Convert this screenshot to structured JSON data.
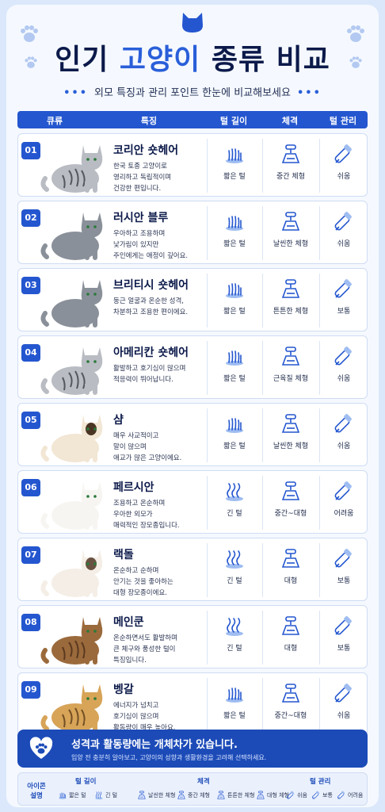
{
  "colors": {
    "accent": "#2456cf",
    "title": "#0c1a4a",
    "highlight": "#2a5fd9"
  },
  "header": {
    "title_part1": "인기",
    "title_hl": "고양이",
    "title_part2": "종류 비교",
    "subtitle": "외모 특징과 관리 포인트 한눈에 비교해보세요"
  },
  "columns": [
    "큐류",
    "특징",
    "털 길이",
    "체격",
    "털 관리"
  ],
  "breeds": [
    {
      "num": "01",
      "name": "코리안 숏헤어",
      "desc": [
        "한국 토종 고양이로",
        "영리하고 독립적이며",
        "건강한 편입니다."
      ],
      "fur": "짧은 털",
      "fur_icon": "short-fur-icon",
      "body": "중간 체형",
      "care": "쉬움",
      "coat": "tabby-silver"
    },
    {
      "num": "02",
      "name": "러시안 블루",
      "desc": [
        "우아하고 조용하며",
        "낯가림이 있지만",
        "주인에게는 애정이 깊어요."
      ],
      "fur": "짧은 털",
      "fur_icon": "short-fur-icon",
      "body": "날씬한 체형",
      "care": "쉬움",
      "coat": "gray"
    },
    {
      "num": "03",
      "name": "브리티시 숏헤어",
      "desc": [
        "둥근 얼굴과 온순한 성격,",
        "차분하고 조용한 편이에요."
      ],
      "fur": "짧은 털",
      "fur_icon": "short-fur-icon",
      "body": "튼튼한 체형",
      "care": "보통",
      "coat": "gray"
    },
    {
      "num": "04",
      "name": "아메리칸 숏헤어",
      "desc": [
        "활발하고 호기심이 많으며",
        "적응력이 뛰어납니다."
      ],
      "fur": "짧은 털",
      "fur_icon": "short-fur-icon",
      "body": "근육질 체형",
      "care": "쉬움",
      "coat": "tabby-silver"
    },
    {
      "num": "05",
      "name": "샴",
      "desc": [
        "매우 사교적이고",
        "말이 많으며",
        "애교가 많은 고양이에요."
      ],
      "fur": "짧은 털",
      "fur_icon": "short-fur-icon",
      "body": "날씬한 체형",
      "care": "쉬움",
      "coat": "siamese"
    },
    {
      "num": "06",
      "name": "페르시안",
      "desc": [
        "조용하고 온순하며",
        "우아한 외모가",
        "매력적인 장모종입니다."
      ],
      "fur": "긴 털",
      "fur_icon": "long-fur-icon",
      "body": "중간~대형",
      "care": "어려움",
      "coat": "white"
    },
    {
      "num": "07",
      "name": "랙돌",
      "desc": [
        "온순하고 순하며",
        "안기는 것을 좋아하는",
        "대형 장모종이에요."
      ],
      "fur": "긴 털",
      "fur_icon": "long-fur-icon",
      "body": "대형",
      "care": "보통",
      "coat": "ragdoll"
    },
    {
      "num": "08",
      "name": "메인쿤",
      "desc": [
        "온순하면서도 활발하며",
        "큰 체구와 풍성한 털이",
        "특징입니다."
      ],
      "fur": "긴 털",
      "fur_icon": "long-fur-icon",
      "body": "대형",
      "care": "보통",
      "coat": "maine"
    },
    {
      "num": "09",
      "name": "벵갈",
      "desc": [
        "에너지가 넘치고",
        "호기심이 많으며",
        "활동량이 매우 높아요."
      ],
      "fur": "짧은 털",
      "fur_icon": "short-fur-icon",
      "body": "중간~대형",
      "care": "쉬움",
      "coat": "bengal"
    }
  ],
  "notice": {
    "title": "성격과 활동량에는 개체차가 있습니다.",
    "text": "입양 전 충분히 알아보고, 고양이의 성향과 생활환경을 고려해 선택하세요."
  },
  "legend": {
    "title": "아이콘 설명",
    "fur_header": "털 길이",
    "fur_items": [
      "짧은 털",
      "긴 털"
    ],
    "body_header": "체격",
    "body_items": [
      "날씬한 체형",
      "중간 체형",
      "튼튼한 체형",
      "대형 체형"
    ],
    "care_header": "털 관리",
    "care_items": [
      "쉬움",
      "보통",
      "어려움"
    ]
  }
}
